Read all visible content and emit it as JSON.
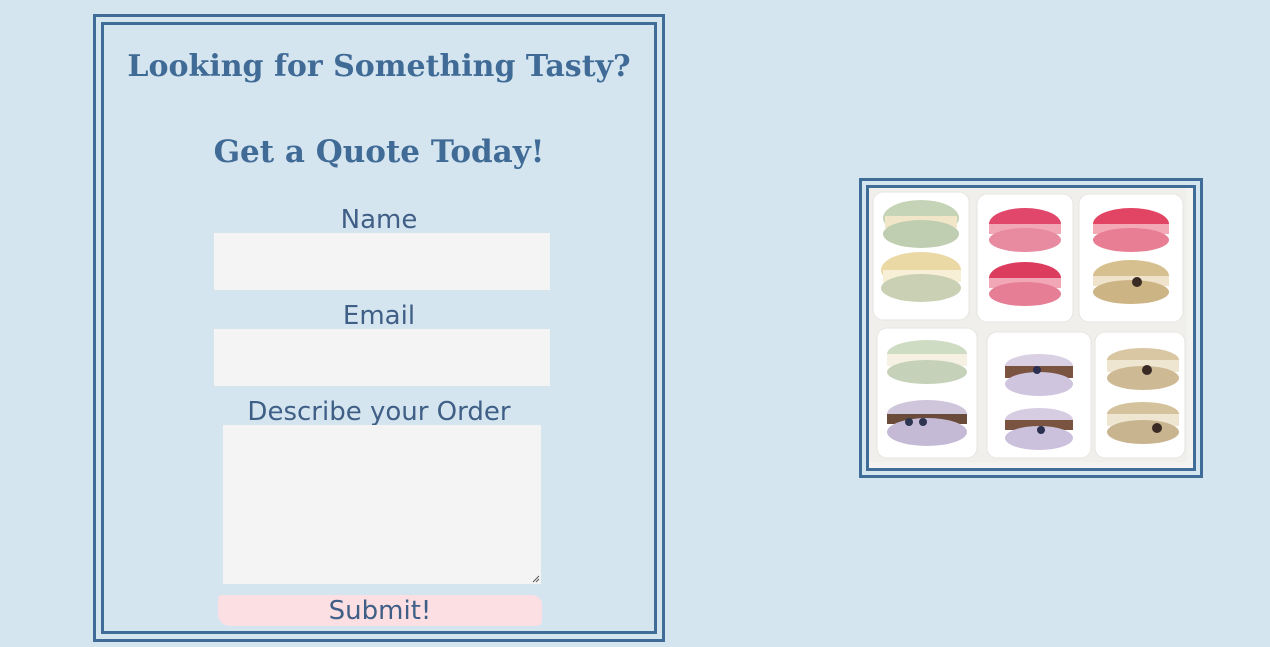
{
  "form": {
    "title": "Looking for Something Tasty?",
    "subtitle": "Get a Quote Today!",
    "name_label": "Name",
    "name_value": "",
    "email_label": "Email",
    "email_value": "",
    "order_label": "Describe your Order",
    "order_value": "",
    "submit_label": "Submit!"
  },
  "photo": {
    "alt": "macarons-photo"
  },
  "colors": {
    "background": "#d5e5ef",
    "accent": "#406c98",
    "input_bg": "#f4f4f4",
    "button_bg": "#fbdfe3"
  }
}
